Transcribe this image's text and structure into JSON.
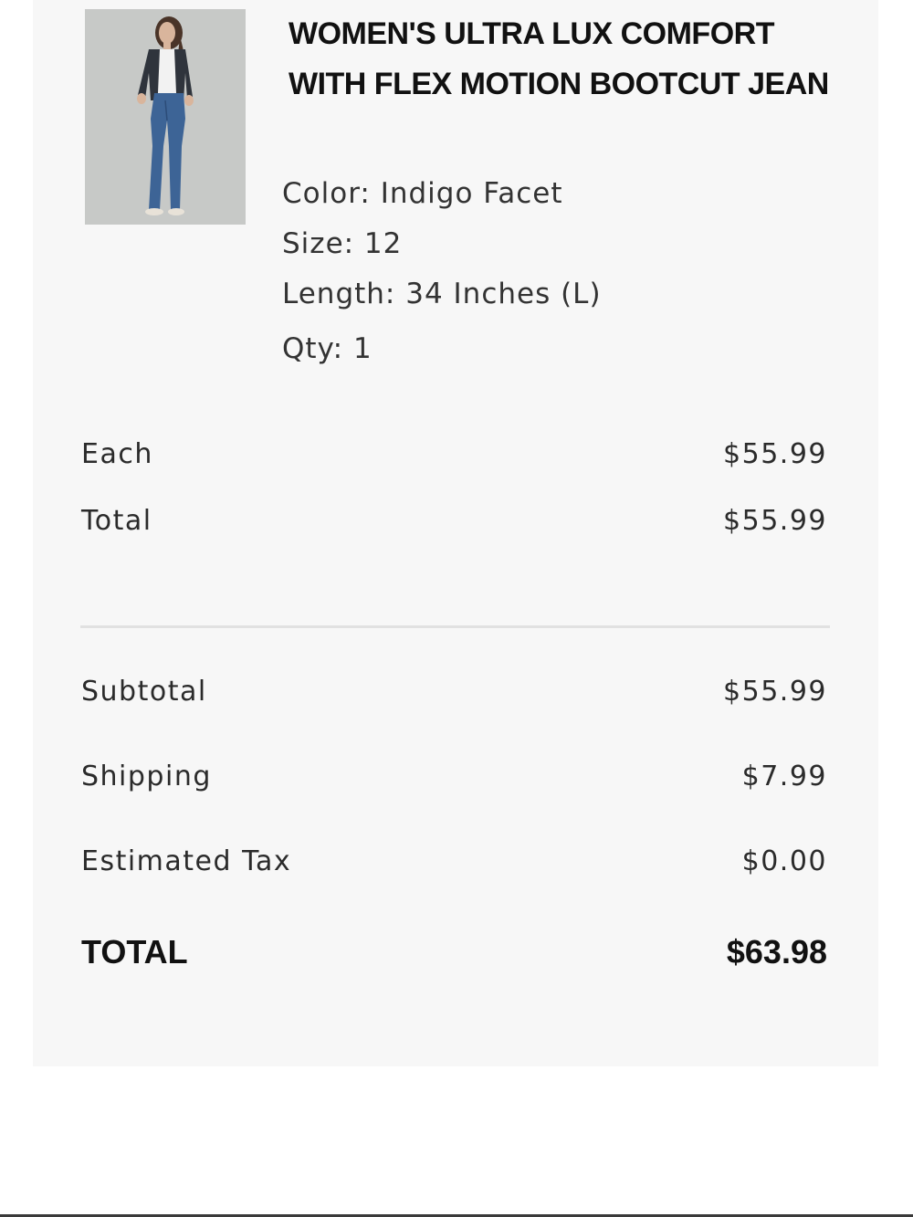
{
  "product": {
    "name": "WOMEN'S ULTRA LUX COMFORT WITH FLEX MOTION BOOTCUT JEAN",
    "color": "Color: Indigo Facet",
    "size": "Size: 12",
    "length": "Length: 34 Inches (L)",
    "qty": "Qty: 1"
  },
  "line_item": {
    "each_label": "Each",
    "each_value": "$55.99",
    "total_label": "Total",
    "total_value": "$55.99"
  },
  "summary": {
    "subtotal_label": "Subtotal",
    "subtotal_value": "$55.99",
    "shipping_label": "Shipping",
    "shipping_value": "$7.99",
    "tax_label": "Estimated Tax",
    "tax_value": "$0.00",
    "grand_total_label": "TOTAL",
    "grand_total_value": "$63.98"
  },
  "colors": {
    "card_background": "#f7f7f7",
    "text": "#2b2b2b",
    "denim": "#3d6496"
  }
}
